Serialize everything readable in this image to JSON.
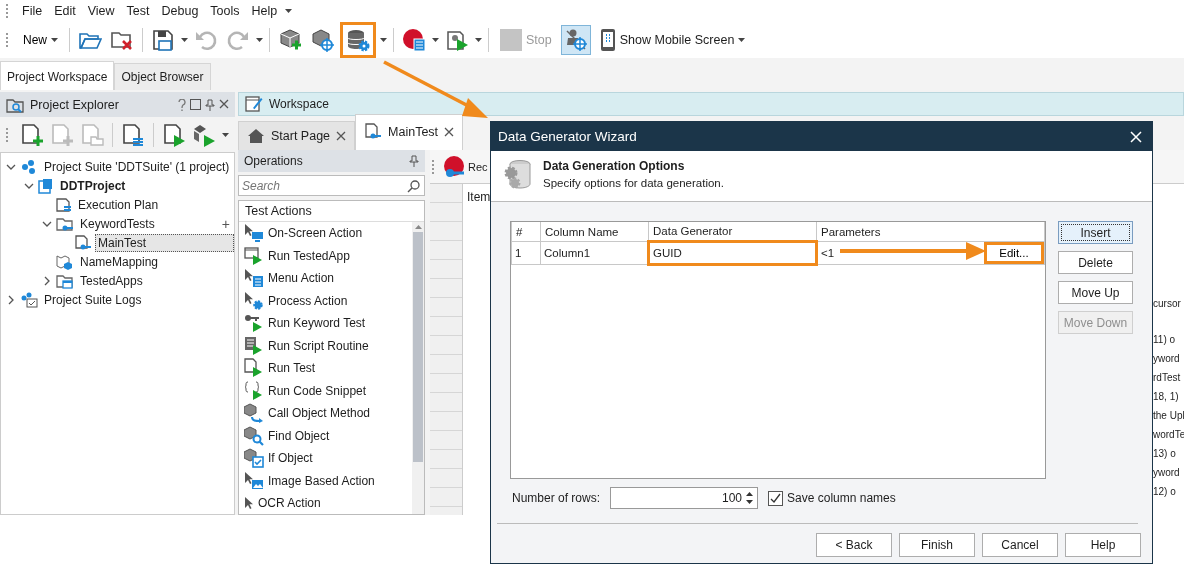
{
  "menu_bar": [
    "File",
    "Edit",
    "View",
    "Test",
    "Debug",
    "Tools",
    "Help"
  ],
  "toolbar": {
    "new_button": "New",
    "undo": {
      "disabled": true
    },
    "redo": {
      "disabled": true
    },
    "data_generator_button": {
      "highlighted": true
    },
    "stop_button": {
      "label": "Stop",
      "disabled": true
    },
    "spy_button": {
      "pressed": true
    },
    "mobile_button": "Show Mobile Screen"
  },
  "left_tabs": [
    {
      "label": "Project Workspace",
      "selected": true
    },
    {
      "label": "Object Browser",
      "selected": false
    }
  ],
  "project_explorer": {
    "title": "Project Explorer",
    "tree": [
      {
        "kind": "suite",
        "label": "Project Suite 'DDTSuite' (1 project)",
        "expanded": true,
        "selected": false,
        "children": [
          {
            "kind": "project",
            "label": "DDTProject",
            "expanded": true,
            "selected": false,
            "children": [
              {
                "kind": "plan",
                "label": "Execution Plan",
                "selected": false
              },
              {
                "kind": "folder",
                "label": "KeywordTests",
                "expanded": true,
                "selected": false,
                "action": "+",
                "children": [
                  {
                    "kind": "test",
                    "label": "MainTest",
                    "selected": true
                  }
                ]
              },
              {
                "kind": "mapping",
                "label": "NameMapping",
                "selected": false
              },
              {
                "kind": "apps",
                "label": "TestedApps",
                "expanded": false,
                "selected": false
              }
            ]
          }
        ]
      },
      {
        "kind": "logs",
        "label": "Project Suite Logs",
        "expanded": false,
        "selected": false
      }
    ]
  },
  "workspace_bar": {
    "title": "Workspace"
  },
  "doc_tabs": [
    {
      "label": "Start Page",
      "selected": false
    },
    {
      "label": "MainTest",
      "selected": true
    }
  ],
  "operations": {
    "title": "Operations",
    "search": {
      "placeholder": "Search"
    },
    "group": "Test Actions",
    "items": [
      {
        "kind": "cursor-screen",
        "label": "On-Screen Action"
      },
      {
        "kind": "run-app",
        "label": "Run TestedApp"
      },
      {
        "kind": "cursor-menu",
        "label": "Menu Action"
      },
      {
        "kind": "cursor-gear",
        "label": "Process Action"
      },
      {
        "kind": "run-key",
        "label": "Run Keyword Test"
      },
      {
        "kind": "run-script",
        "label": "Run Script Routine"
      },
      {
        "kind": "run-doc",
        "label": "Run Test"
      },
      {
        "kind": "run-snippet",
        "label": "Run Code Snippet"
      },
      {
        "kind": "cube-call",
        "label": "Call Object Method"
      },
      {
        "kind": "cube-find",
        "label": "Find Object"
      },
      {
        "kind": "cube-check",
        "label": "If Object"
      },
      {
        "kind": "cursor-image",
        "label": "Image Based Action"
      },
      {
        "kind": "cursor-plain",
        "label": "OCR Action"
      }
    ]
  },
  "editor": {
    "record_label": "Rec",
    "column_1": "Item",
    "log_fragments": [
      "cursor",
      "11) o",
      "yword",
      "rdTest",
      "18, 1)",
      "the Upl",
      "wordTe",
      "13) o",
      "yword",
      "12) o"
    ]
  },
  "dialog": {
    "title": "Data Generator Wizard",
    "heading": "Data Generation Options",
    "subtitle": "Specify options for data generation.",
    "columns": [
      "#",
      "Column Name",
      "Data Generator",
      "Parameters"
    ],
    "rows": [
      {
        "cells": [
          {
            "text": "1",
            "highlighted": false
          },
          {
            "text": "Column1",
            "highlighted": false
          },
          {
            "text": "GUID",
            "highlighted": true
          },
          {
            "text": "<1",
            "highlighted": false
          }
        ],
        "edit_button": {
          "label": "Edit...",
          "highlighted": true
        }
      }
    ],
    "side_buttons": [
      {
        "label": "Insert",
        "focused": true,
        "disabled": false
      },
      {
        "label": "Delete",
        "focused": false,
        "disabled": false
      },
      {
        "label": "Move Up",
        "focused": false,
        "disabled": false
      },
      {
        "label": "Move Down",
        "focused": false,
        "disabled": true
      }
    ],
    "rows_label": "Number of rows:",
    "rows_value": "100",
    "save_names": {
      "label": "Save column names",
      "checked": true
    },
    "footer_buttons": [
      "< Back",
      "Finish",
      "Cancel",
      "Help"
    ]
  }
}
